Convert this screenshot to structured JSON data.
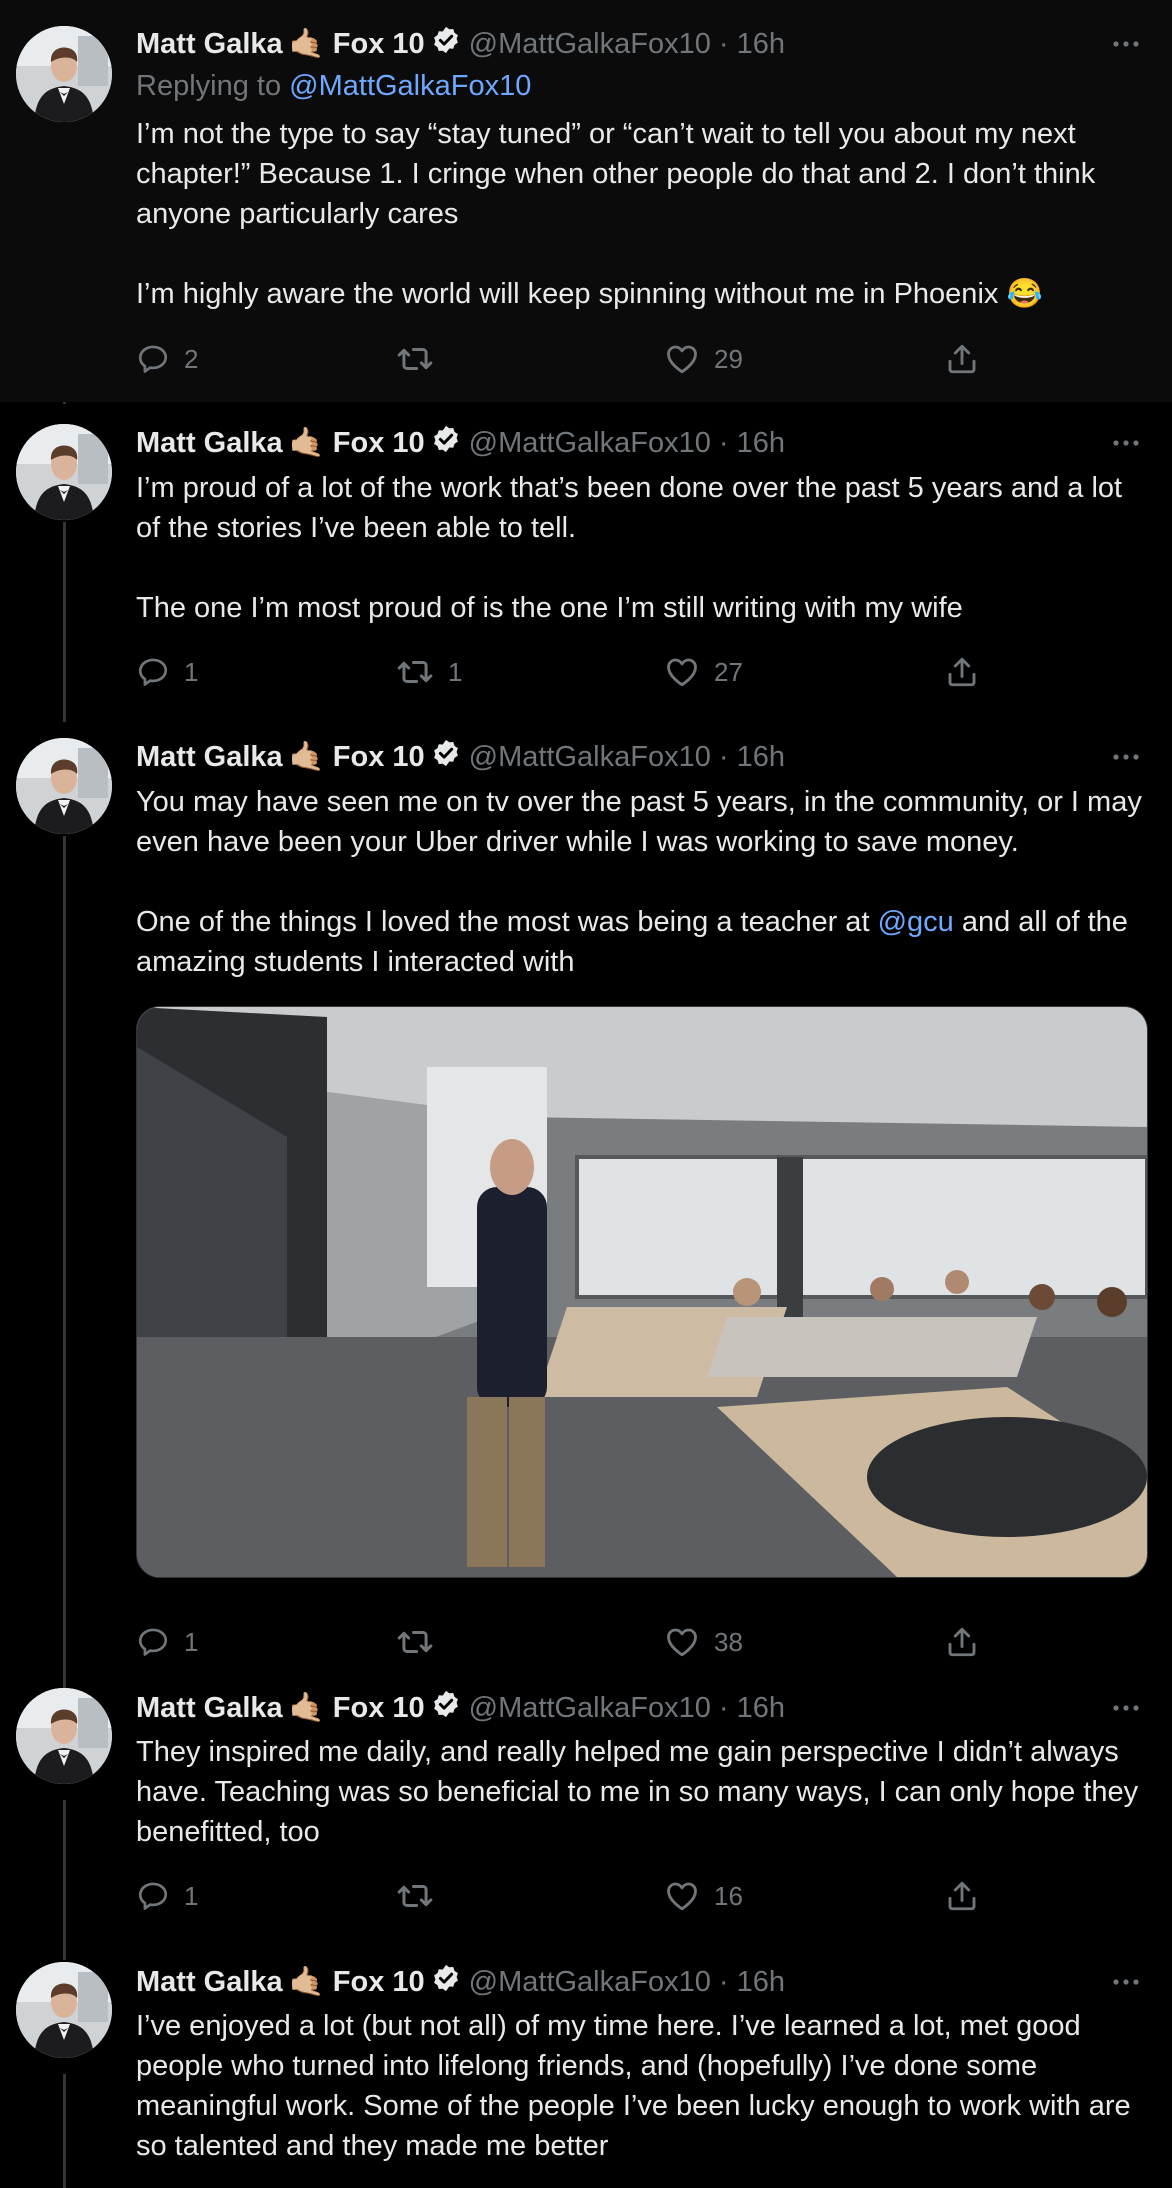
{
  "author": {
    "name_part1": "Matt Galka",
    "name_emoji": "🤙🏼",
    "name_part2": "Fox 10",
    "handle": "@MattGalkaFox10",
    "time": "· 16h"
  },
  "tweets": [
    {
      "replying_to_label": "Replying to",
      "replying_to_handle": "@MattGalkaFox10",
      "text": "I’m not the type to say “stay tuned” or “can’t wait to tell you about my next chapter!” Because 1. I cringe when other people do that and 2. I don’t think anyone particularly cares\n\nI’m highly aware the world will keep spinning without me in Phoenix 😂",
      "replies": "2",
      "retweets": "",
      "likes": "29"
    },
    {
      "text": "I’m proud of a lot of the work that’s been done over the past 5 years and a lot of the stories I’ve been able to tell.\n\nThe one I’m most proud of is the one I’m still writing with my wife",
      "replies": "1",
      "retweets": "1",
      "likes": "27"
    },
    {
      "text_before_mention": "You may have seen me on tv over the past 5 years, in the community, or I may even have been your Uber driver while I was working to save money.\n\nOne of the things I loved the most was being a teacher at ",
      "mention": "@gcu",
      "text_after_mention": " and all of the amazing students I interacted with",
      "replies": "1",
      "retweets": "",
      "likes": "38"
    },
    {
      "text": "They inspired me daily, and really helped me gain perspective I didn’t always have. Teaching was so beneficial to me in so many ways, I can only hope they benefitted, too",
      "replies": "1",
      "retweets": "",
      "likes": "16"
    },
    {
      "text": "I’ve enjoyed a lot (but not all) of my time here. I’ve learned a lot, met good people who turned into lifelong friends, and (hopefully) I’ve done some meaningful work. Some of the people I’ve been lucky enough to work with are so talented and they made me better"
    }
  ],
  "colors": {
    "background": "#000000",
    "text": "#e7e9ea",
    "muted": "#71767b",
    "link": "#6ea8ff",
    "thread_line": "#333639"
  },
  "icons": [
    "more-icon",
    "verified-icon",
    "reply-icon",
    "retweet-icon",
    "like-icon",
    "share-icon"
  ]
}
